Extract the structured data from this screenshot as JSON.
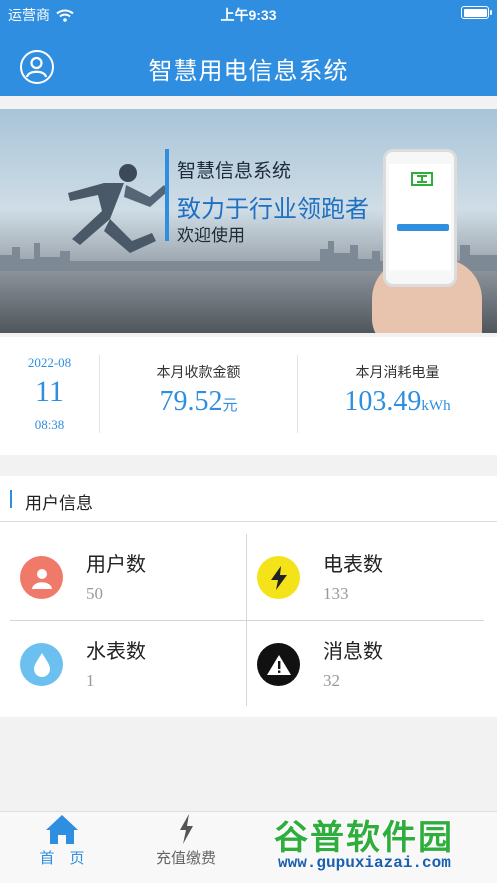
{
  "status_bar": {
    "carrier": "运营商",
    "time": "上午9:33",
    "wifi_icon": "wifi-icon",
    "battery_icon": "battery-icon"
  },
  "header": {
    "title": "智慧用电信息系统",
    "avatar_icon": "user-circle-icon",
    "bg_color": "#2f8ee0"
  },
  "banner": {
    "line1": "智慧信息系统",
    "line2": "致力于行业领跑者",
    "line3": "欢迎使用"
  },
  "stats": {
    "date": {
      "year_month": "2022-08",
      "day": "11",
      "time": "08:38"
    },
    "collection": {
      "label": "本月收款金额",
      "value": "79.52",
      "unit": "元"
    },
    "consumption": {
      "label": "本月消耗电量",
      "value": "103.49",
      "unit": "kWh"
    }
  },
  "user_info": {
    "title": "用户信息",
    "items": [
      {
        "name": "用户数",
        "count": "50",
        "icon": "user-icon",
        "color": "#f07a6a"
      },
      {
        "name": "电表数",
        "count": "133",
        "icon": "lightning-icon",
        "color": "#f5e31a"
      },
      {
        "name": "水表数",
        "count": "1",
        "icon": "water-drop-icon",
        "color": "#6cc0f0"
      },
      {
        "name": "消息数",
        "count": "32",
        "icon": "warning-icon",
        "color": "#111111"
      }
    ]
  },
  "tabbar": {
    "tabs": [
      {
        "label": "首　页",
        "icon": "home-icon",
        "active": true
      },
      {
        "label": "充值缴费",
        "icon": "lightning-icon",
        "active": false
      }
    ]
  },
  "watermark": {
    "text": "谷普软件园",
    "url": "www.gupuxiazai.com"
  }
}
